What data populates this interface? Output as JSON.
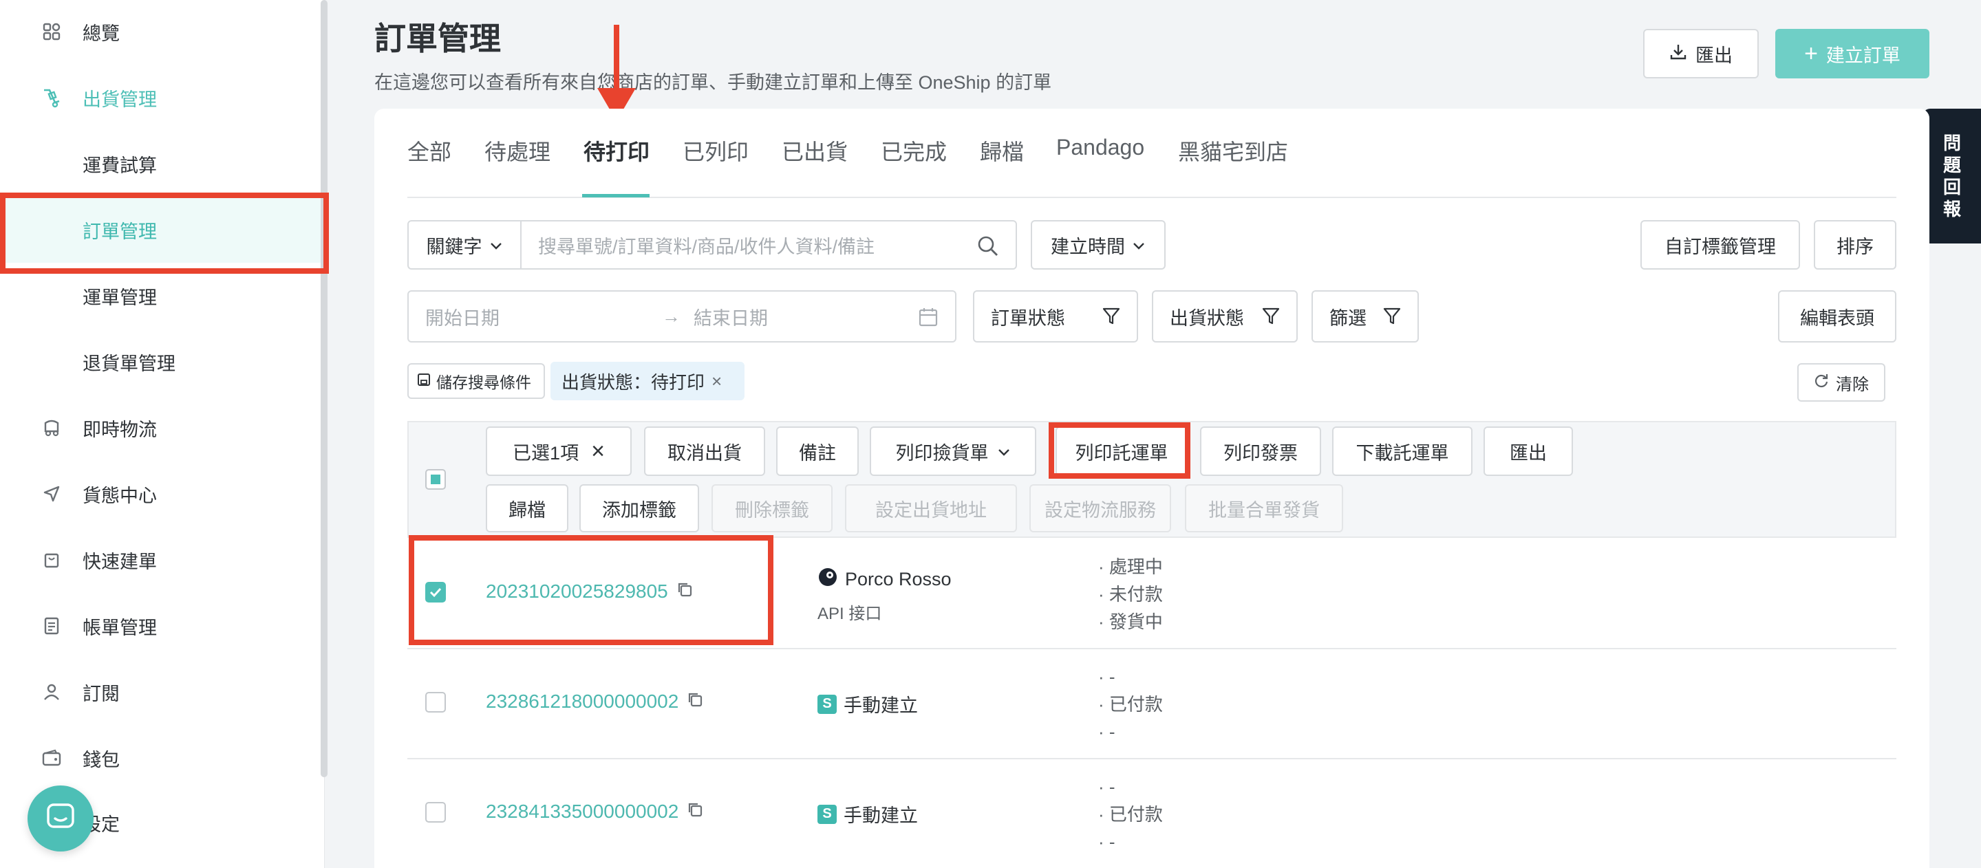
{
  "sidebar": {
    "items": [
      {
        "label": "總覽",
        "icon": "grid-icon"
      },
      {
        "label": "出貨管理",
        "icon": "shipping-icon"
      },
      {
        "label": "運費試算",
        "icon": ""
      },
      {
        "label": "訂單管理",
        "icon": ""
      },
      {
        "label": "運單管理",
        "icon": ""
      },
      {
        "label": "退貨單管理",
        "icon": ""
      },
      {
        "label": "即時物流",
        "icon": "delivery-icon"
      },
      {
        "label": "貨態中心",
        "icon": "send-icon"
      },
      {
        "label": "快速建單",
        "icon": "bag-icon"
      },
      {
        "label": "帳單管理",
        "icon": "bill-icon"
      },
      {
        "label": "訂閱",
        "icon": "user-icon"
      },
      {
        "label": "錢包",
        "icon": "wallet-icon"
      },
      {
        "label": "設定",
        "icon": "gear-icon"
      }
    ]
  },
  "header": {
    "title": "訂單管理",
    "subtitle": "在這邊您可以查看所有來自您商店的訂單、手動建立訂單和上傳至 OneShip 的訂單",
    "export_label": "匯出",
    "create_label": "建立訂單"
  },
  "feedback": {
    "chars": [
      "問",
      "題",
      "回",
      "報"
    ]
  },
  "tabs": [
    {
      "label": "全部"
    },
    {
      "label": "待處理"
    },
    {
      "label": "待打印"
    },
    {
      "label": "已列印"
    },
    {
      "label": "已出貨"
    },
    {
      "label": "已完成"
    },
    {
      "label": "歸檔"
    },
    {
      "label": "Pandago"
    },
    {
      "label": "黑貓宅到店"
    }
  ],
  "filters": {
    "keyword_label": "關鍵字",
    "search_placeholder": "搜尋單號/訂單資料/商品/收件人資料/備註",
    "created_time_label": "建立時間",
    "custom_tag_label": "自訂標籤管理",
    "sort_label": "排序",
    "start_date_placeholder": "開始日期",
    "end_date_placeholder": "結束日期",
    "order_status_label": "訂單狀態",
    "shipping_status_label": "出貨狀態",
    "filter_label": "篩選",
    "edit_columns_label": "編輯表頭",
    "save_search_label": "儲存搜尋條件",
    "active_filter_label": "出貨狀態：待打印",
    "clear_label": "清除"
  },
  "bulk_actions": {
    "selected_label": "已選1項",
    "row1": [
      "取消出貨",
      "備註",
      "列印撿貨單",
      "列印託運單",
      "列印發票",
      "下載託運單",
      "匯出"
    ],
    "row2": [
      "歸檔",
      "添加標籤",
      "刪除標籤",
      "設定出貨地址",
      "設定物流服務",
      "批量合單發貨"
    ]
  },
  "orders": [
    {
      "id": "20231020025829805",
      "shop": "Porco Rosso",
      "source": "API 接口",
      "statuses": [
        "處理中",
        "未付款",
        "發貨中"
      ],
      "checked": true
    },
    {
      "id": "232861218000000002",
      "shop": "手動建立",
      "source": "",
      "statuses": [
        "-",
        "已付款",
        "-"
      ],
      "checked": false
    },
    {
      "id": "232841335000000002",
      "shop": "手動建立",
      "source": "",
      "statuses": [
        "-",
        "已付款",
        "-"
      ],
      "checked": false
    }
  ],
  "colors": {
    "accent": "#4dbfb6",
    "highlight": "#e8432e",
    "feedback_bg": "#16202c"
  }
}
